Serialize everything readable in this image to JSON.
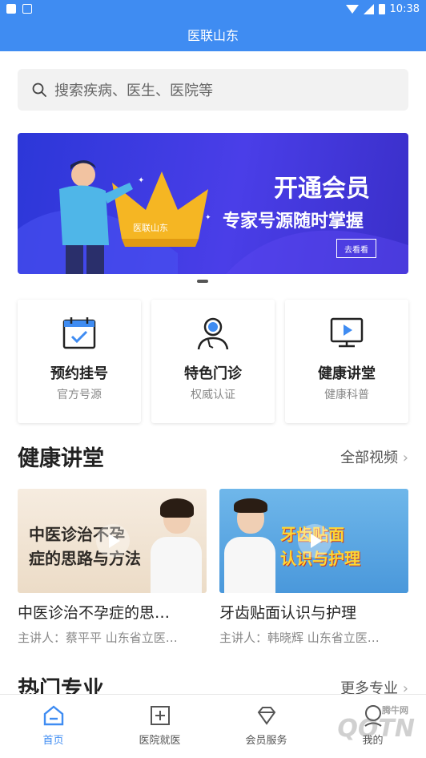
{
  "status_bar": {
    "time": "10:38"
  },
  "app": {
    "title": "医联山东"
  },
  "search": {
    "placeholder": "搜索疾病、医生、医院等"
  },
  "banner": {
    "title": "开通会员",
    "subtitle": "专家号源随时掌握",
    "button": "去看看",
    "crown_label": "医联山东"
  },
  "services": [
    {
      "name": "预约挂号",
      "sub": "官方号源",
      "icon": "calendar-check-icon"
    },
    {
      "name": "特色门诊",
      "sub": "权威认证",
      "icon": "doctor-stethoscope-icon"
    },
    {
      "name": "健康讲堂",
      "sub": "健康科普",
      "icon": "video-screen-icon"
    }
  ],
  "health_section": {
    "title": "健康讲堂",
    "more": "全部视频"
  },
  "videos": [
    {
      "thumb_text_1": "中医诊治不孕",
      "thumb_text_2": "症的思路与方法",
      "title": "中医诊治不孕症的思…",
      "meta": "主讲人：蔡平平  山东省立医…"
    },
    {
      "thumb_text_1": "牙齿贴面",
      "thumb_text_2": "认识与护理",
      "title": "牙齿贴面认识与护理",
      "meta": "主讲人：韩晓辉  山东省立医…"
    }
  ],
  "hot_section": {
    "title": "热门专业",
    "more": "更多专业"
  },
  "nav": [
    {
      "label": "首页",
      "icon": "home-icon",
      "active": true
    },
    {
      "label": "医院就医",
      "icon": "hospital-plus-icon",
      "active": false
    },
    {
      "label": "会员服务",
      "icon": "member-diamond-icon",
      "active": false
    },
    {
      "label": "我的",
      "icon": "user-icon",
      "active": false
    }
  ],
  "watermark": {
    "text": "QQTN",
    "small": "腾牛网"
  },
  "colors": {
    "brand": "#3f8cf2",
    "banner": "#3a34e0",
    "highlight": "#ffd632"
  }
}
